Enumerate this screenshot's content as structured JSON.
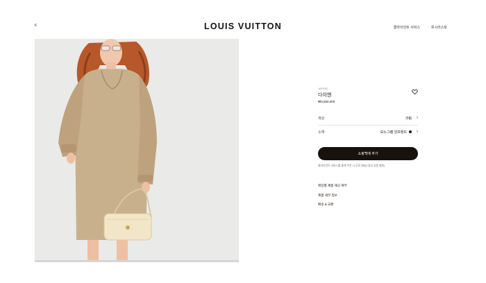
{
  "header": {
    "back_label": "Κ",
    "logo": "LOUIS VUITTON",
    "nav": [
      "클라이언트 서비스",
      "위시리스트"
    ]
  },
  "product": {
    "sku": "1AF9X8",
    "name": "다이앤",
    "price": "₩3,550,000",
    "options": [
      {
        "label": "색상",
        "value": "크림"
      },
      {
        "label": "소재",
        "value": "모노그램 앙프렝뜨"
      }
    ],
    "cart_label": "쇼핑백에 추가",
    "notice": "클라이언트 서비스를 통해 주문 시 무료 배송(*일부 상품 제외)",
    "links": [
      "매장별 제품 재고 여부",
      "제품 세부 정보",
      "배송 & 교환"
    ]
  },
  "colors": {
    "accent": "#19110b",
    "background": "#ffffff",
    "image_bg": "#ebebea"
  },
  "icons": [
    "heart-icon",
    "chevron-right-icon"
  ]
}
